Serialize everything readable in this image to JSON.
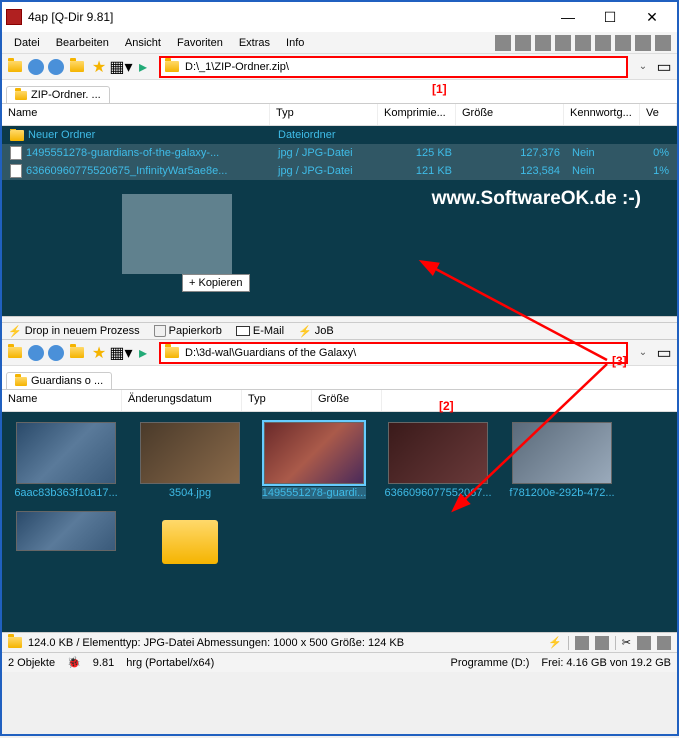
{
  "window": {
    "title": "4ap  [Q-Dir 9.81]"
  },
  "menu": {
    "datei": "Datei",
    "bearbeiten": "Bearbeiten",
    "ansicht": "Ansicht",
    "favoriten": "Favoriten",
    "extras": "Extras",
    "info": "Info"
  },
  "pane1": {
    "address": "D:\\_1\\ZIP-Ordner.zip\\",
    "tab": "ZIP-Ordner. ...",
    "cols": {
      "name": "Name",
      "typ": "Typ",
      "komp": "Komprimie...",
      "groesse": "Größe",
      "kennwort": "Kennwortg...",
      "ve": "Ve"
    },
    "rows": [
      {
        "name": "Neuer Ordner",
        "typ": "Dateiordner",
        "komp": "",
        "groesse": "",
        "kennwort": "",
        "ve": "",
        "folder": true
      },
      {
        "name": "1495551278-guardians-of-the-galaxy-...",
        "typ": "jpg / JPG-Datei",
        "komp": "125 KB",
        "groesse": "127,376",
        "kennwort": "Nein",
        "ve": "0%",
        "sel": true
      },
      {
        "name": "63660960775520675_InfinityWar5ae8e...",
        "typ": "jpg / JPG-Datei",
        "komp": "121 KB",
        "groesse": "123,584",
        "kennwort": "Nein",
        "ve": "1%",
        "sel": true
      }
    ],
    "drag": "+ Kopieren"
  },
  "mid": {
    "drop": "Drop in neuem Prozess",
    "papierkorb": "Papierkorb",
    "email": "E-Mail",
    "job": "JoB"
  },
  "pane2": {
    "address": "D:\\3d-wal\\Guardians of the Galaxy\\",
    "tab": "Guardians o ...",
    "cols": {
      "name": "Name",
      "aend": "Änderungsdatum",
      "typ": "Typ",
      "groesse": "Größe"
    },
    "thumbs": [
      {
        "lbl": "6aac83b363f10a17...",
        "cls": ""
      },
      {
        "lbl": "3504.jpg",
        "cls": "alt1"
      },
      {
        "lbl": "1495551278-guardi...",
        "cls": "alt2",
        "hl": true
      },
      {
        "lbl": "6366096077552067...",
        "cls": "alt3"
      },
      {
        "lbl": "f781200e-292b-472...",
        "cls": "alt4"
      }
    ]
  },
  "status": "124.0 KB / Elementtyp: JPG-Datei Abmessungen: 1000 x 500 Größe: 124 KB",
  "bottom": {
    "obj": "2 Objekte",
    "ver": "9.81",
    "mode": "hrg  (Portabel/x64)",
    "drive": "Programme (D:)",
    "free": "Frei: 4.16 GB von 19.2 GB"
  },
  "watermark": "www.SoftwareOK.de :-)",
  "annot": {
    "a1": "[1]",
    "a2": "[2]",
    "a3": "[3]"
  }
}
